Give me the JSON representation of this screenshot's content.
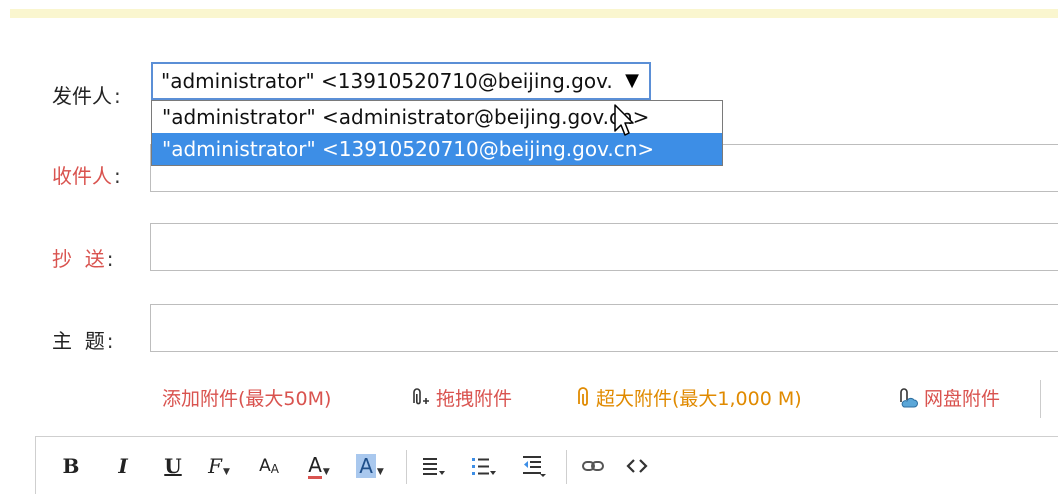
{
  "form": {
    "sender_label": "发件人",
    "to_label": "收件人",
    "cc_label": "抄  送",
    "subject_label": "主  题",
    "colon": ":"
  },
  "sender_select": {
    "value": "\"administrator\" <13910520710@beijing.gov.cn>",
    "options": [
      "\"administrator\" <administrator@beijing.gov.cn>",
      "\"administrator\" <13910520710@beijing.gov.cn>"
    ],
    "selected_index": 1
  },
  "attachments": {
    "add": "添加附件(最大50M)",
    "drag": "拖拽附件",
    "large": "超大附件(最大1,000 M)",
    "netdisk": "网盘附件"
  },
  "toolbar": {
    "bold": "B",
    "italic": "I",
    "underline": "U",
    "font_family": "F",
    "font_size": "A",
    "font_color": "A",
    "bg_color": "A"
  },
  "colors": {
    "accent_red": "#d9534f",
    "select_highlight": "#3d8ee6",
    "large_attach": "#e08a00",
    "top_bar": "#faf6cf"
  }
}
